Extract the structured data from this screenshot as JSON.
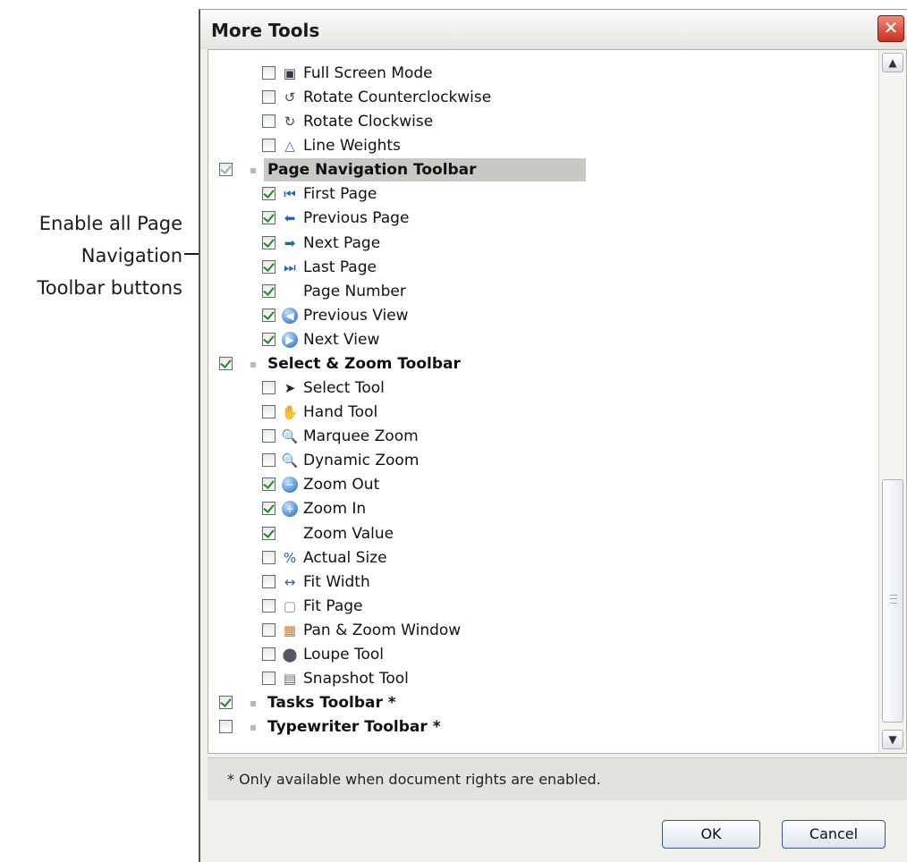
{
  "callout": {
    "lines": [
      "Enable all Page",
      "Navigation",
      "Toolbar buttons"
    ]
  },
  "dialog": {
    "title": "More Tools",
    "close_label": "✕",
    "footer_note": "* Only available when document rights are enabled.",
    "ok_label": "OK",
    "cancel_label": "Cancel"
  },
  "list": {
    "items": [
      {
        "label": "Full Screen Mode",
        "checked": false,
        "type": "tool",
        "icon": "monitor-icon"
      },
      {
        "label": "Rotate Counterclockwise",
        "checked": false,
        "type": "tool",
        "icon": "rotate-ccw-icon"
      },
      {
        "label": "Rotate Clockwise",
        "checked": false,
        "type": "tool",
        "icon": "rotate-cw-icon"
      },
      {
        "label": "Line Weights",
        "checked": false,
        "type": "tool",
        "icon": "line-weights-icon"
      },
      {
        "label": "Page Navigation Toolbar",
        "checked": true,
        "type": "group",
        "selected": true,
        "dim": true
      },
      {
        "label": "First Page",
        "checked": true,
        "type": "tool",
        "icon": "first-page-icon"
      },
      {
        "label": "Previous Page",
        "checked": true,
        "type": "tool",
        "icon": "previous-page-icon"
      },
      {
        "label": "Next Page",
        "checked": true,
        "type": "tool",
        "icon": "next-page-icon"
      },
      {
        "label": "Last Page",
        "checked": true,
        "type": "tool",
        "icon": "last-page-icon"
      },
      {
        "label": "Page Number",
        "checked": true,
        "type": "tool",
        "icon": ""
      },
      {
        "label": "Previous View",
        "checked": true,
        "type": "tool",
        "icon": "previous-view-icon"
      },
      {
        "label": "Next View",
        "checked": true,
        "type": "tool",
        "icon": "next-view-icon"
      },
      {
        "label": "Select & Zoom Toolbar",
        "checked": true,
        "type": "group"
      },
      {
        "label": "Select Tool",
        "checked": false,
        "type": "tool",
        "icon": "select-arrow-icon"
      },
      {
        "label": "Hand Tool",
        "checked": false,
        "type": "tool",
        "icon": "hand-icon"
      },
      {
        "label": "Marquee Zoom",
        "checked": false,
        "type": "tool",
        "icon": "marquee-zoom-icon"
      },
      {
        "label": "Dynamic Zoom",
        "checked": false,
        "type": "tool",
        "icon": "dynamic-zoom-icon"
      },
      {
        "label": "Zoom Out",
        "checked": true,
        "type": "tool",
        "icon": "zoom-out-icon"
      },
      {
        "label": "Zoom In",
        "checked": true,
        "type": "tool",
        "icon": "zoom-in-icon"
      },
      {
        "label": "Zoom Value",
        "checked": true,
        "type": "tool",
        "icon": ""
      },
      {
        "label": "Actual Size",
        "checked": false,
        "type": "tool",
        "icon": "actual-size-icon"
      },
      {
        "label": "Fit Width",
        "checked": false,
        "type": "tool",
        "icon": "fit-width-icon"
      },
      {
        "label": "Fit Page",
        "checked": false,
        "type": "tool",
        "icon": "fit-page-icon"
      },
      {
        "label": "Pan & Zoom Window",
        "checked": false,
        "type": "tool",
        "icon": "pan-zoom-window-icon"
      },
      {
        "label": "Loupe Tool",
        "checked": false,
        "type": "tool",
        "icon": "loupe-icon"
      },
      {
        "label": "Snapshot Tool",
        "checked": false,
        "type": "tool",
        "icon": "snapshot-icon"
      },
      {
        "label": "Tasks Toolbar *",
        "checked": true,
        "type": "group"
      },
      {
        "label": "Typewriter Toolbar *",
        "checked": false,
        "type": "group"
      }
    ]
  },
  "colors": {
    "check_green": "#1f8a1f",
    "close_red": "#c8321e",
    "selected_row": "#c8c8c4"
  }
}
